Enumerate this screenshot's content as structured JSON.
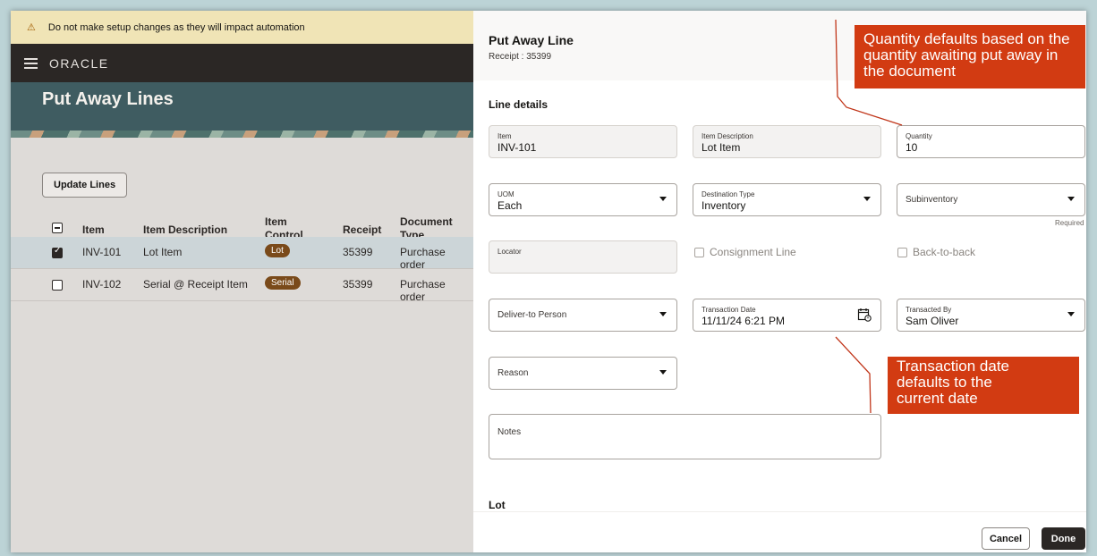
{
  "warning": {
    "text": "Do not make setup changes as they will impact automation"
  },
  "nav": {
    "brand": "ORACLE"
  },
  "page": {
    "title": "Put Away Lines"
  },
  "toolbar": {
    "update_lines": "Update Lines"
  },
  "table": {
    "columns": {
      "item": "Item",
      "description": "Item Description",
      "control_1": "Item",
      "control_2": "Control",
      "receipt": "Receipt",
      "doctype_1": "Document",
      "doctype_2": "Type"
    },
    "rows": [
      {
        "item": "INV-101",
        "description": "Lot Item",
        "control": "Lot",
        "receipt": "35399",
        "doctype": "Purchase order",
        "checked": true
      },
      {
        "item": "INV-102",
        "description": "Serial @ Receipt Item",
        "control": "Serial",
        "receipt": "35399",
        "doctype": "Purchase order",
        "checked": false
      }
    ]
  },
  "drawer": {
    "title": "Put Away Line",
    "subtitle": "Receipt : 35399",
    "section_line": "Line details",
    "section_lot": "Lot",
    "item": {
      "label": "Item",
      "value": "INV-101"
    },
    "item_description": {
      "label": "Item Description",
      "value": "Lot Item"
    },
    "quantity": {
      "label": "Quantity",
      "value": "10"
    },
    "uom": {
      "label": "UOM",
      "value": "Each"
    },
    "destination_type": {
      "label": "Destination Type",
      "value": "Inventory"
    },
    "subinventory": {
      "placeholder": "Subinventory",
      "required": "Required"
    },
    "locator": {
      "label": "Locator"
    },
    "consignment": "Consignment Line",
    "back_to_back": "Back-to-back",
    "deliver_to": {
      "placeholder": "Deliver-to Person"
    },
    "transaction_date": {
      "label": "Transaction Date",
      "value": "11/11/24 6:21 PM"
    },
    "transacted_by": {
      "label": "Transacted By",
      "value": "Sam Oliver"
    },
    "reason": {
      "placeholder": "Reason"
    },
    "notes": {
      "label": "Notes"
    },
    "cancel": "Cancel",
    "done": "Done"
  },
  "callouts": {
    "quantity": "Quantity defaults based on the quantity awaiting put away in the document",
    "date_1": "Transaction date",
    "date_2": "defaults to the",
    "date_3": "current date"
  }
}
